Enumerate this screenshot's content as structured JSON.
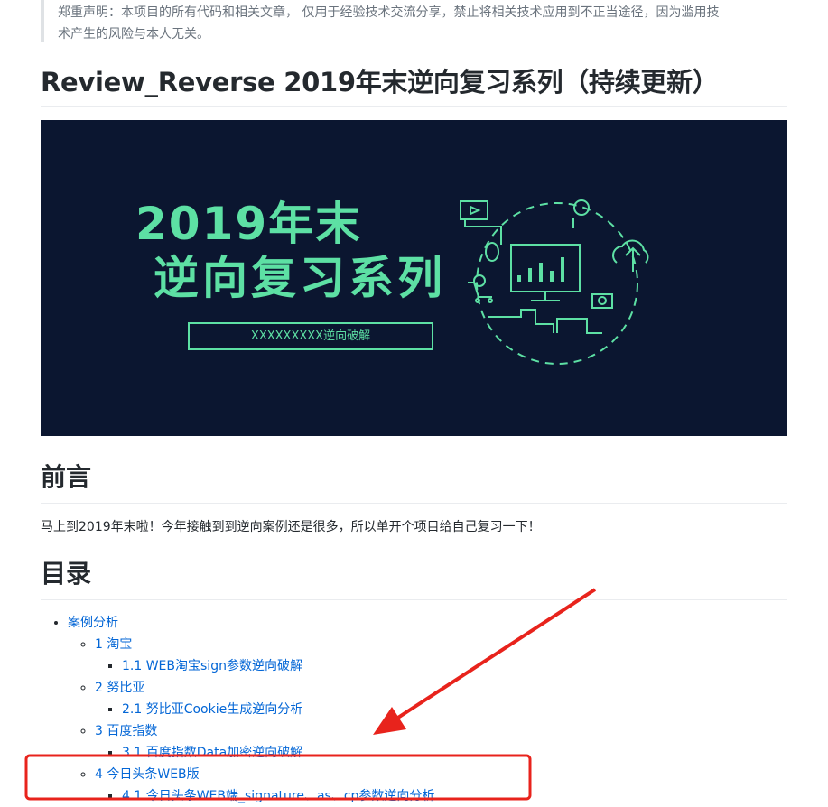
{
  "disclaimer": {
    "line1": "郑重声明：本项目的所有代码和相关文章， 仅用于经验技术交流分享，禁止将相关技术应用到不正当途径，因为滥用技",
    "line2": "术产生的风险与本人无关。"
  },
  "title": "Review_Reverse 2019年末逆向复习系列（持续更新）",
  "banner": {
    "line1": "2019年末",
    "line2": "逆向复习系列",
    "box_text": "XXXXXXXXX逆向破解",
    "accent_color": "#5de0a4",
    "background_color": "#0b1630"
  },
  "preface": {
    "heading": "前言",
    "text": "马上到2019年末啦！今年接触到到逆向案例还是很多，所以单开个项目给自己复习一下！"
  },
  "toc": {
    "heading": "目录",
    "root": "案例分析",
    "sections": [
      {
        "label": "1 淘宝",
        "items": [
          "1.1 WEB淘宝sign参数逆向破解"
        ]
      },
      {
        "label": "2 努比亚",
        "items": [
          "2.1 努比亚Cookie生成逆向分析"
        ]
      },
      {
        "label": "3 百度指数",
        "items": [
          "3.1 百度指数Data加密逆向破解"
        ]
      },
      {
        "label": "4 今日头条WEB版",
        "items": [
          "4.1 今日头条WEB端_signature、as、cp参数逆向分析"
        ]
      }
    ]
  },
  "annotation": {
    "color": "#e8231c",
    "icons": [
      "red-arrow",
      "red-highlight-box"
    ]
  }
}
